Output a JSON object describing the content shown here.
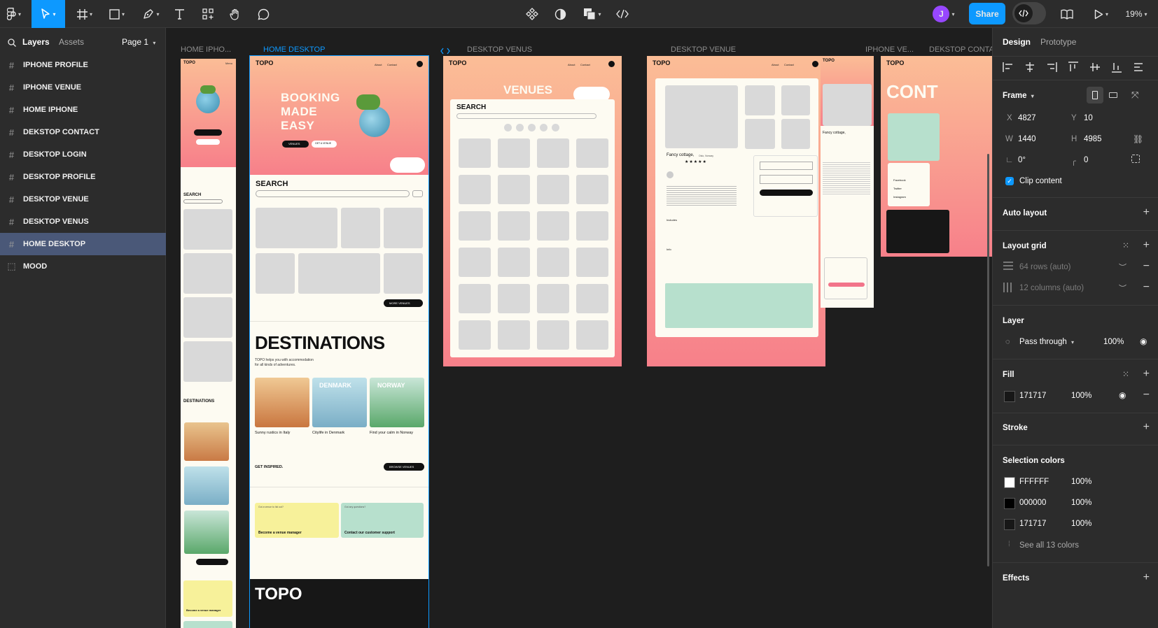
{
  "toolbar": {
    "share_label": "Share",
    "zoom": "19%",
    "avatar_initial": "J",
    "accent": "#0d99ff",
    "avatar_color": "#9747ff"
  },
  "left_panel": {
    "tab_layers": "Layers",
    "tab_assets": "Assets",
    "page_label": "Page 1",
    "layers": [
      {
        "label": "IPHONE PROFILE"
      },
      {
        "label": "IPHONE VENUE"
      },
      {
        "label": "HOME IPHONE"
      },
      {
        "label": "DEKSTOP CONTACT"
      },
      {
        "label": "DESKTOP LOGIN"
      },
      {
        "label": "DESKTOP PROFILE"
      },
      {
        "label": "DESKTOP VENUE"
      },
      {
        "label": "DESKTOP VENUS"
      },
      {
        "label": "HOME DESKTOP",
        "selected": true
      },
      {
        "label": "MOOD"
      }
    ]
  },
  "canvas": {
    "frame_labels": {
      "home_iphone": "HOME IPHO...",
      "home_desktop": "HOME DESKTOP",
      "desktop_venus": "DESKTOP VENUS",
      "desktop_venue": "DESKTOP VENUE",
      "iphone_venue": "IPHONE VE...",
      "desktop_contact": "DEKSTOP CONTA..."
    },
    "brand": "TOPO",
    "nav_about": "About",
    "nav_contact": "Contact",
    "nav_menu": "Menu",
    "hero_title_1": "BOOKING",
    "hero_title_2": "MADE",
    "hero_title_3": "EASY",
    "btn_venues": "VENUES",
    "btn_get_a_venue": "GET A VENUE",
    "search_label": "SEARCH",
    "more_venues": "MORE VENUES",
    "destinations_title": "DESTINATIONS",
    "destinations_sub_1": "TOPO helps you with accommodation",
    "destinations_sub_2": "for all kinds of adventures.",
    "dest_denmark": "DENMARK",
    "dest_norway": "NORWAY",
    "dest_caption_1": "Sunny rustics in Italy",
    "dest_caption_2": "Citylife in Denmark",
    "dest_caption_3": "Find your calm in Norway",
    "get_inspired": "GET INSPIRED.",
    "browse_venues": "BROWSE VENUES",
    "card_1_small": "Got a venue to list out?",
    "card_1_title": "Become a venue manager",
    "card_2_small": "Got any questions?",
    "card_2_title": "Contact our customer support",
    "footer_brand": "TOPO",
    "venues_title": "VENUES",
    "venue_name": "Fancy cottage,",
    "venue_place": "Oslo, Norway",
    "venue_includes": "Includes",
    "venue_info": "Info",
    "contact_title": "CONT",
    "contact_facebook": "Facebook",
    "contact_twitter": "Twitter",
    "contact_instagram": "Instagram",
    "mobile_become": "Become a venue manager"
  },
  "right_panel": {
    "tab_design": "Design",
    "tab_prototype": "Prototype",
    "frame_label": "Frame",
    "x_label": "X",
    "x_value": "4827",
    "y_label": "Y",
    "y_value": "10",
    "w_label": "W",
    "w_value": "1440",
    "h_label": "H",
    "h_value": "4985",
    "rotation_value": "0°",
    "radius_value": "0",
    "clip_content": "Clip content",
    "auto_layout": "Auto layout",
    "layout_grid": "Layout grid",
    "grid_rows": "64 rows (auto)",
    "grid_columns": "12 columns (auto)",
    "layer": "Layer",
    "blend_mode": "Pass through",
    "layer_opacity": "100%",
    "fill": "Fill",
    "fill_hex": "171717",
    "fill_opacity": "100%",
    "stroke": "Stroke",
    "selection_colors": "Selection colors",
    "colors": [
      {
        "hex": "FFFFFF",
        "opacity": "100%",
        "swatch": "#ffffff"
      },
      {
        "hex": "000000",
        "opacity": "100%",
        "swatch": "#000000"
      },
      {
        "hex": "171717",
        "opacity": "100%",
        "swatch": "#171717"
      }
    ],
    "see_all_colors": "See all 13 colors",
    "effects": "Effects"
  }
}
